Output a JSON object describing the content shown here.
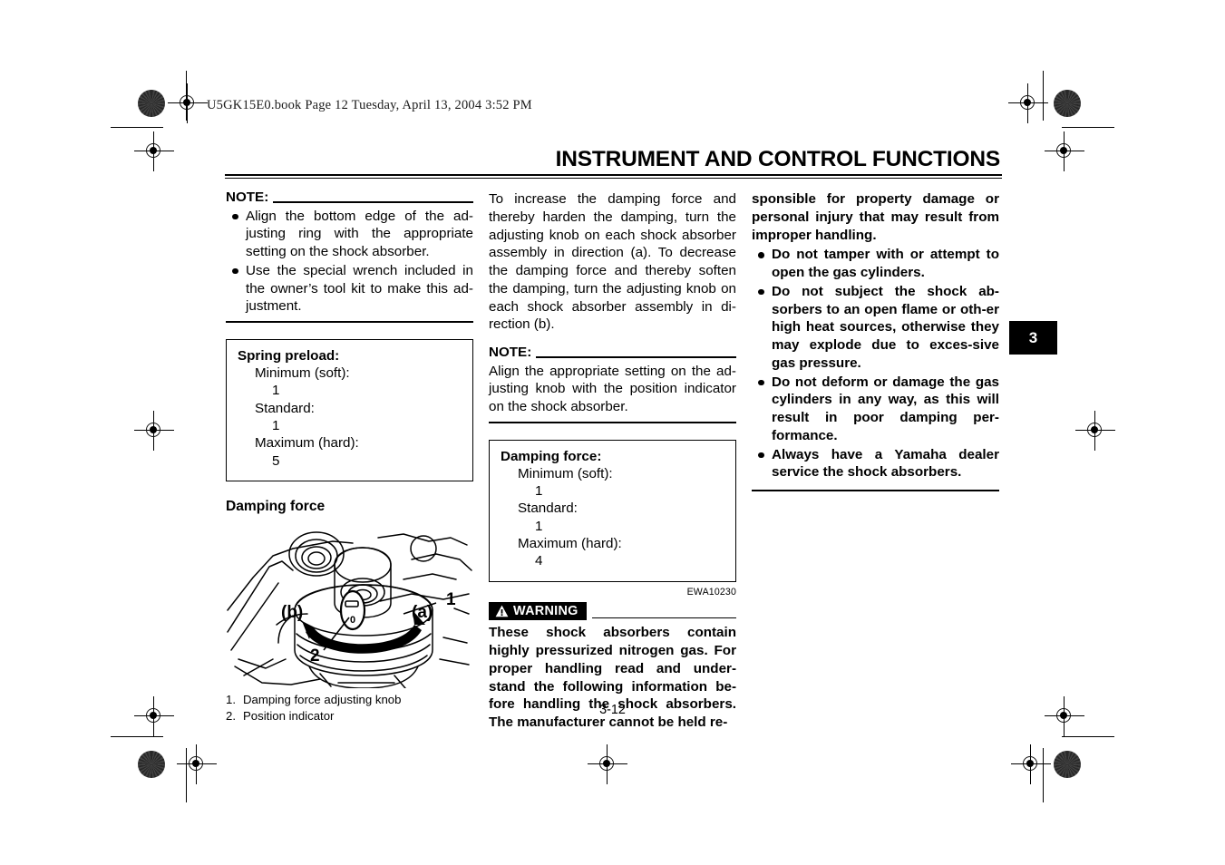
{
  "header": {
    "book_tag": "U5GK15E0.book  Page 12  Tuesday, April 13, 2004  3:52 PM"
  },
  "running_head": {
    "title": "INSTRUMENT AND CONTROL FUNCTIONS"
  },
  "chapter_tab": {
    "number": "3"
  },
  "left_column": {
    "note": {
      "label": "NOTE:",
      "bullets": [
        "Align the bottom edge of the ad-justing ring with the appropriate setting on the shock absorber.",
        "Use the special wrench included in the owner’s tool kit to make this ad-justment."
      ]
    },
    "spec_box": {
      "title": "Spring preload:",
      "rows": [
        {
          "key": "Minimum (soft):",
          "value": "1"
        },
        {
          "key": "Standard:",
          "value": "1"
        },
        {
          "key": "Maximum (hard):",
          "value": "5"
        }
      ]
    },
    "section_heading": "Damping force",
    "figure": {
      "labels": {
        "callout_1": "1",
        "callout_2": "2",
        "direction_a": "(a)",
        "direction_b": "(b)",
        "indicator_value": "0"
      },
      "caption": [
        {
          "num": "1.",
          "text": "Damping force adjusting knob"
        },
        {
          "num": "2.",
          "text": "Position indicator"
        }
      ]
    }
  },
  "middle_column": {
    "paragraph": "To increase the damping force and thereby harden the damping, turn the adjusting knob on each shock absorber assembly in direction (a). To decrease the damping force and thereby soften the damping, turn the adjusting knob on each shock absorber assembly in di-rection (b).",
    "note": {
      "label": "NOTE:",
      "text": "Align the appropriate setting on the ad-justing knob with the position indicator on the shock absorber."
    },
    "spec_box": {
      "title": "Damping force:",
      "rows": [
        {
          "key": "Minimum (soft):",
          "value": "1"
        },
        {
          "key": "Standard:",
          "value": "1"
        },
        {
          "key": "Maximum (hard):",
          "value": "4"
        }
      ]
    },
    "art_code": "EWA10230",
    "warning": {
      "badge_label": "WARNING",
      "text": "These shock absorbers contain highly pressurized nitrogen gas. For proper handling read and under-stand the following information be-fore handling the shock absorbers. The manufacturer cannot be held re-"
    }
  },
  "right_column": {
    "continued_text": "sponsible for property damage or personal injury that may result from improper handling.",
    "bullets": [
      "Do not tamper with or attempt to open the gas cylinders.",
      "Do not subject the shock ab-sorbers to an open flame or oth-er high heat sources, otherwise they may explode due to exces-sive gas pressure.",
      "Do not deform or damage the gas cylinders in any way, as this will result in poor damping per-formance.",
      "Always have a Yamaha dealer service the shock absorbers."
    ]
  },
  "footer": {
    "page_number": "3-12"
  }
}
